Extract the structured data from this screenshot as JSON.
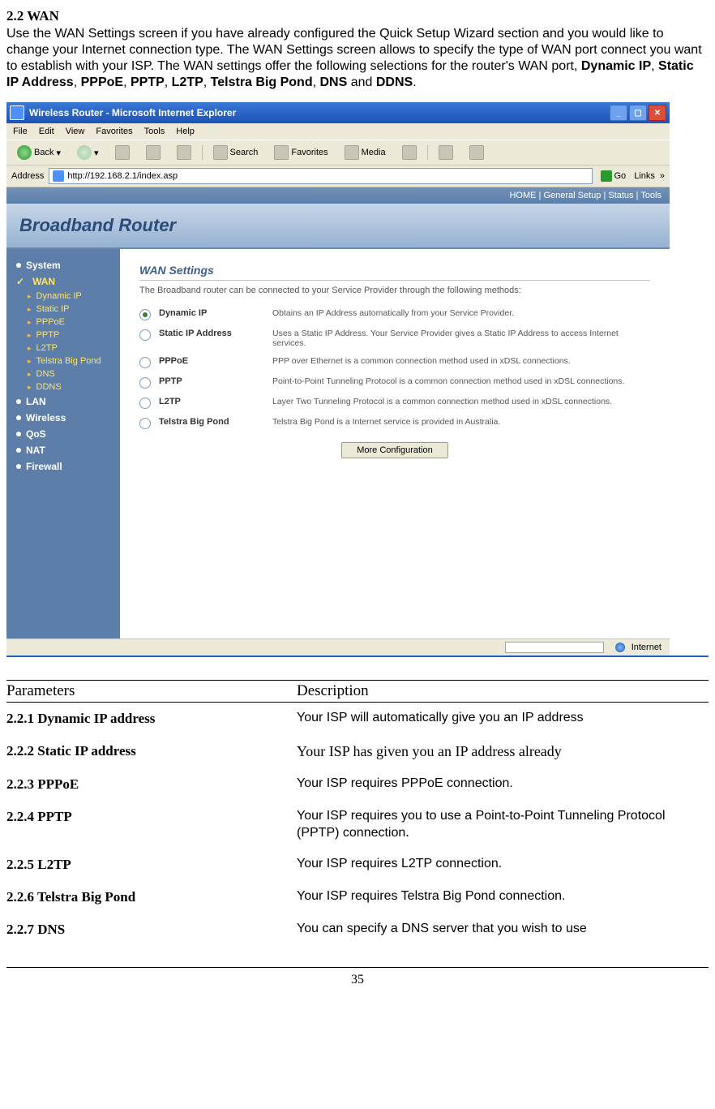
{
  "section": {
    "title": "2.2 WAN"
  },
  "intro": {
    "t1": "Use the WAN Settings screen if you have already configured the Quick Setup Wizard section and you would like to change your Internet connection type. The WAN Settings screen allows to specify the type of WAN port connect you want to establish with your ISP. The WAN settings offer the following selections for the router's WAN port, ",
    "b1": "Dynamic IP",
    "s1": ", ",
    "b2": "Static IP Address",
    "s2": ", ",
    "b3": "PPPoE",
    "s3": ", ",
    "b4": "PPTP",
    "s4": ", ",
    "b5": "L2TP",
    "s5": ", ",
    "b6": "Telstra Big Pond",
    "s6": ", ",
    "b7": "DNS",
    "s7": " and ",
    "b8": "DDNS",
    "s8": "."
  },
  "window": {
    "title": "Wireless Router - Microsoft Internet Explorer",
    "menus": [
      "File",
      "Edit",
      "View",
      "Favorites",
      "Tools",
      "Help"
    ],
    "toolbar": {
      "back": "Back",
      "search": "Search",
      "favorites": "Favorites",
      "media": "Media"
    },
    "address_label": "Address",
    "address_value": "http://192.168.2.1/index.asp",
    "go": "Go",
    "links": "Links",
    "topnav": "HOME | General Setup | Status | Tools",
    "banner": "Broadband Router",
    "sidenav": {
      "system": "System",
      "wan": "WAN",
      "subs": [
        "Dynamic IP",
        "Static IP",
        "PPPoE",
        "PPTP",
        "L2TP",
        "Telstra Big Pond",
        "DNS",
        "DDNS"
      ],
      "lan": "LAN",
      "wireless": "Wireless",
      "qos": "QoS",
      "nat": "NAT",
      "firewall": "Firewall"
    },
    "panel": {
      "title": "WAN Settings",
      "lead": "The Broadband router can be connected to your Service Provider through the following methods:",
      "options": [
        {
          "label": "Dynamic IP",
          "desc": "Obtains an IP Address automatically from your Service Provider.",
          "checked": true
        },
        {
          "label": "Static IP Address",
          "desc": "Uses a Static IP Address. Your Service Provider gives a Static IP Address to access Internet services.",
          "checked": false
        },
        {
          "label": "PPPoE",
          "desc": "PPP over Ethernet is a common connection method used in xDSL connections.",
          "checked": false
        },
        {
          "label": "PPTP",
          "desc": "Point-to-Point Tunneling Protocol is a common connection method used in xDSL connections.",
          "checked": false
        },
        {
          "label": "L2TP",
          "desc": "Layer Two Tunneling Protocol is a common connection method used in xDSL connections.",
          "checked": false
        },
        {
          "label": "Telstra Big Pond",
          "desc": "Telstra Big Pond is a Internet service is provided in Australia.",
          "checked": false
        }
      ],
      "more": "More Configuration"
    },
    "status": {
      "internet": "Internet"
    }
  },
  "table": {
    "h1": "Parameters",
    "h2": "Description",
    "rows": [
      {
        "p": "2.2.1 Dynamic IP address",
        "d": "Your ISP will automatically give you an IP address",
        "serif": false
      },
      {
        "p": "2.2.2 Static IP address",
        "d": "Your ISP has given you an IP address already",
        "serif": true
      },
      {
        "p": "2.2.3 PPPoE",
        "d": "Your ISP requires PPPoE connection.",
        "serif": false
      },
      {
        "p": "2.2.4 PPTP",
        "d": "Your ISP requires you to use a Point-to-Point Tunneling Protocol (PPTP) connection",
        "tail": ".",
        "serif": false
      },
      {
        "p": "2.2.5 L2TP",
        "d": "Your ISP requires L2TP connection.",
        "serif": false
      },
      {
        "p": "2.2.6 Telstra Big Pond",
        "d": "Your ISP requires Telstra Big Pond connection.",
        "serif": false
      },
      {
        "p": "2.2.7 DNS",
        "d": "You can specify a DNS server that you wish to use",
        "serif": false
      }
    ]
  },
  "page_number": "35"
}
